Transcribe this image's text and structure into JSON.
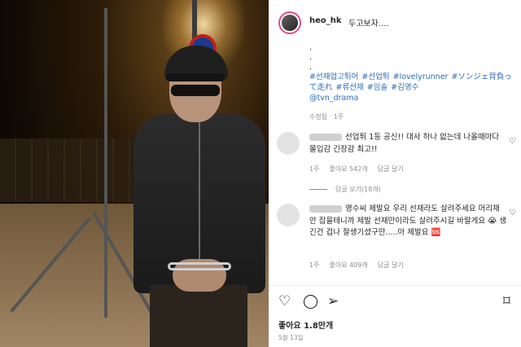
{
  "post": {
    "username": "heo_hk",
    "caption_head": "두고보자....",
    "caption_dots": [
      ".",
      ".",
      "."
    ],
    "hashtags": [
      "#선재업고튀어",
      "#선업튀",
      "#lovelyrunner",
      "#ソンジェ背負って走れ",
      "#류선재",
      "#임솔",
      "#김영수"
    ],
    "mention": "@tvn_drama",
    "edited": "수정됨 · 1주"
  },
  "comments": [
    {
      "text": "선업튀 1등 공신!! 대사 하나 없는데 나올때마다 몰입감 긴장감 최고!!",
      "time": "1주",
      "likes": "좋아요 542개",
      "reply": "답글 달기"
    },
    {
      "text": "영수씨 제발요 우리 선재라도 살려주세요 머리채 안 잡을테니까 제발 선재만이라도 살려주시길 바랄게요 😭 생긴건 겁나 잘생기셨구만.....아 제발요 🆘",
      "time": "1주",
      "likes": "좋아요 409개",
      "reply": "답글 달기"
    }
  ],
  "replies_toggle": "답글 보기(18개)",
  "footer": {
    "likes": "좋아요 1.8만개",
    "date": "5월 13일"
  },
  "icons": {
    "heart": "heart-icon",
    "comment": "comment-icon",
    "share": "share-icon",
    "bookmark": "bookmark-icon"
  }
}
